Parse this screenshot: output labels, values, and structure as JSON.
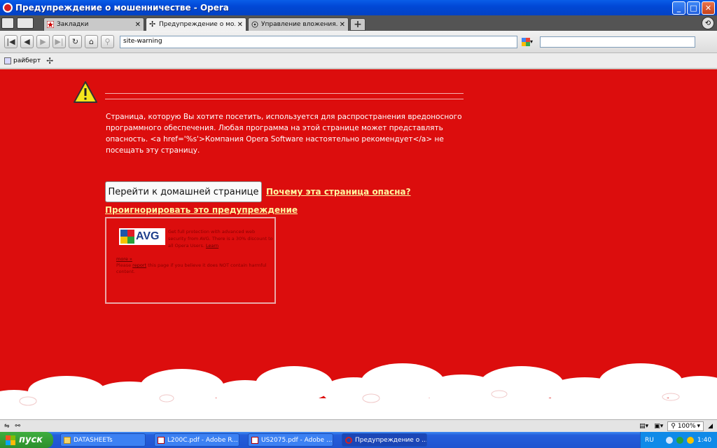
{
  "window": {
    "title": "Предупреждение о мошенничестве - Opera",
    "controls": {
      "minimize": "_",
      "maximize": "□",
      "close": "✕"
    }
  },
  "tabs": [
    {
      "label": "Закладки",
      "active": false,
      "icon": "bookmark-icon"
    },
    {
      "label": "Предупреждение о мо...",
      "active": true,
      "icon": "opera-tab-icon"
    },
    {
      "label": "Управление вложения...",
      "active": false,
      "icon": "settings-icon"
    }
  ],
  "toolbar": {
    "address": "site-warning",
    "search_engine_icon": "google-icon"
  },
  "bookmarks_bar": {
    "items": [
      {
        "label": "райберт"
      }
    ]
  },
  "page": {
    "warning_text": "Страница, которую Вы хотите посетить, используется для распространения вредоносного программного обеспечения. Любая программа на этой странице может представлять опасность. <a href='%s'>Компания Opera Software настоятельно рекомендует</a> не посещать эту страницу.",
    "home_button": "Перейти к домашней странице",
    "why_link": "Почему эта страница опасна?",
    "ignore_link": "Проигнорировать это предупреждение",
    "avg": {
      "logo": "AVG",
      "promo": "Get full protection with advanced web security from AVG. There is a 30% discount to all Opera Users.",
      "promo_link": "Learn",
      "more": "more »",
      "report_prefix": "Please",
      "report_link": "report",
      "report_suffix": "this page if you believe it does NOT contain harmful content."
    }
  },
  "statusbar": {
    "zoom": "100%"
  },
  "taskbar": {
    "start": "пуск",
    "tasks": [
      {
        "label": "DATASHEETs",
        "active": false
      },
      {
        "label": "L200C.pdf - Adobe R...",
        "active": false
      },
      {
        "label": "US2075.pdf - Adobe ...",
        "active": false
      },
      {
        "label": "Предупреждение о ...",
        "active": true
      }
    ],
    "lang": "RU",
    "clock": "1:40"
  }
}
